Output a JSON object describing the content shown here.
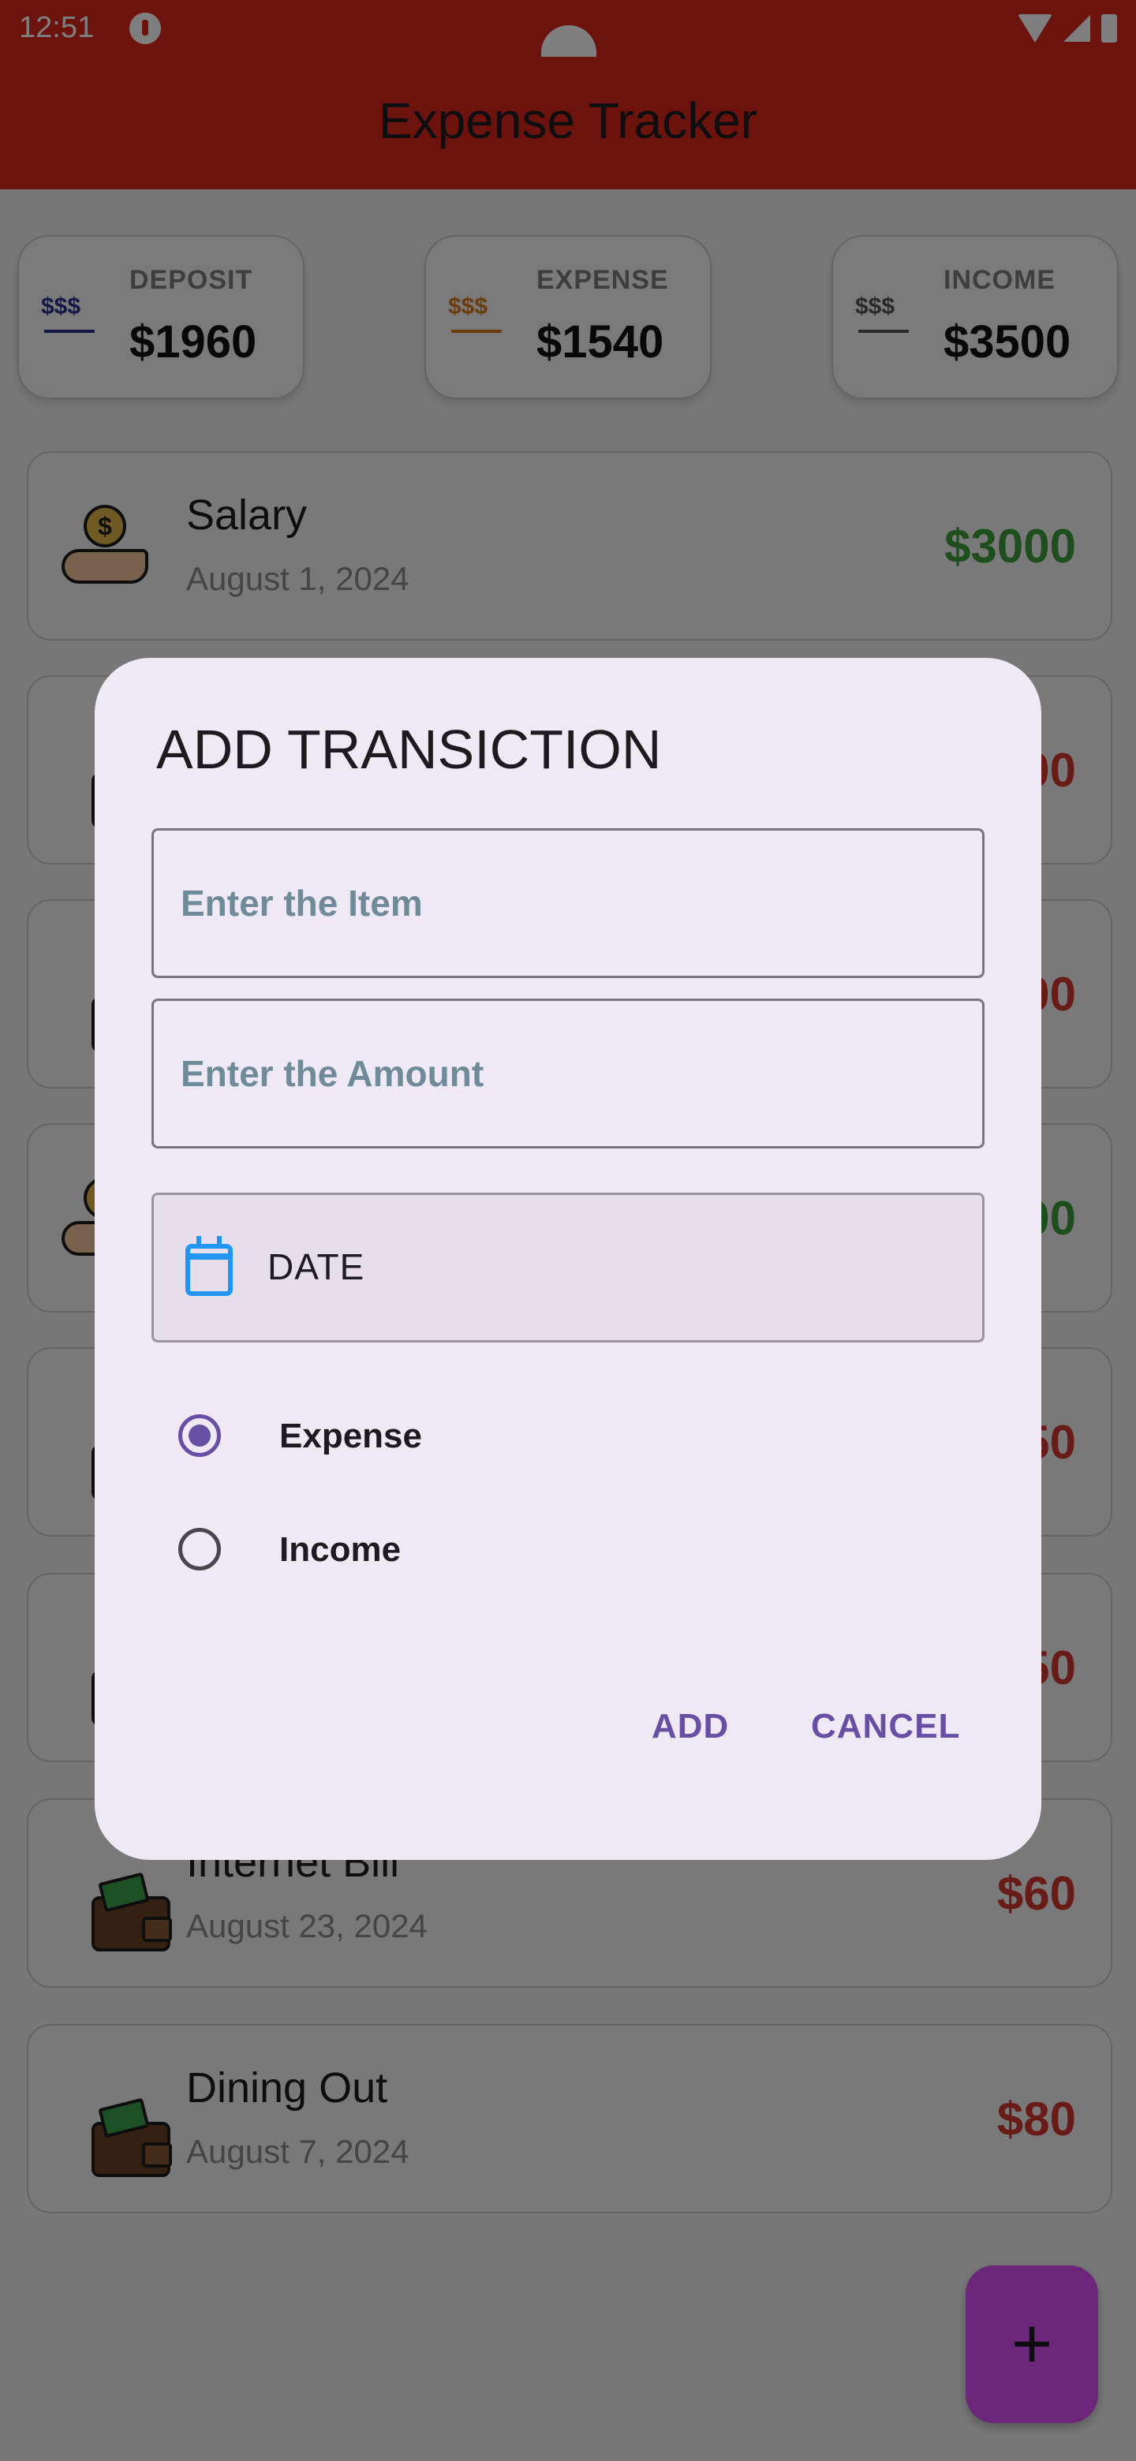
{
  "status_bar": {
    "time": "12:51"
  },
  "app_bar": {
    "title": "Expense Tracker"
  },
  "summary": [
    {
      "label": "DEPOSIT",
      "value": "$1960",
      "symbol": "$$$",
      "color": "#2b2f8f"
    },
    {
      "label": "EXPENSE",
      "value": "$1540",
      "symbol": "$$$",
      "color": "#d77a1a"
    },
    {
      "label": "INCOME",
      "value": "$3500",
      "symbol": "$$$",
      "color": "#555555"
    }
  ],
  "transactions": [
    {
      "name": "Salary",
      "date": "August 1, 2024",
      "amount": "$3000",
      "type": "income",
      "icon": "coin-hand-icon"
    },
    {
      "name": "",
      "date": "",
      "amount": "00",
      "type": "expense",
      "icon": "wallet-icon"
    },
    {
      "name": "",
      "date": "",
      "amount": "00",
      "type": "expense",
      "icon": "wallet-icon"
    },
    {
      "name": "",
      "date": "",
      "amount": "00",
      "type": "income",
      "icon": "coin-hand-icon"
    },
    {
      "name": "",
      "date": "",
      "amount": "50",
      "type": "expense",
      "icon": "wallet-icon"
    },
    {
      "name": "",
      "date": "",
      "amount": "50",
      "type": "expense",
      "icon": "wallet-icon"
    },
    {
      "name": "Internet Bill",
      "date": "August 23, 2024",
      "amount": "$60",
      "type": "expense",
      "icon": "wallet-icon"
    },
    {
      "name": "Dining Out",
      "date": "August 7, 2024",
      "amount": "$80",
      "type": "expense",
      "icon": "wallet-icon"
    }
  ],
  "fab": {
    "label": "+"
  },
  "dialog": {
    "title": "ADD TRANSICTION",
    "item_placeholder": "Enter the Item",
    "amount_placeholder": "Enter the Amount",
    "date_label": "DATE",
    "radio_expense": "Expense",
    "radio_income": "Income",
    "selected": "Expense",
    "add_label": "ADD",
    "cancel_label": "CANCEL"
  },
  "colors": {
    "app_bar": "#d9261c",
    "accent": "#6750a4",
    "income": "#3d9b3d",
    "expense": "#d0372f",
    "fab": "#d94cf2",
    "calendar": "#2196f3"
  }
}
